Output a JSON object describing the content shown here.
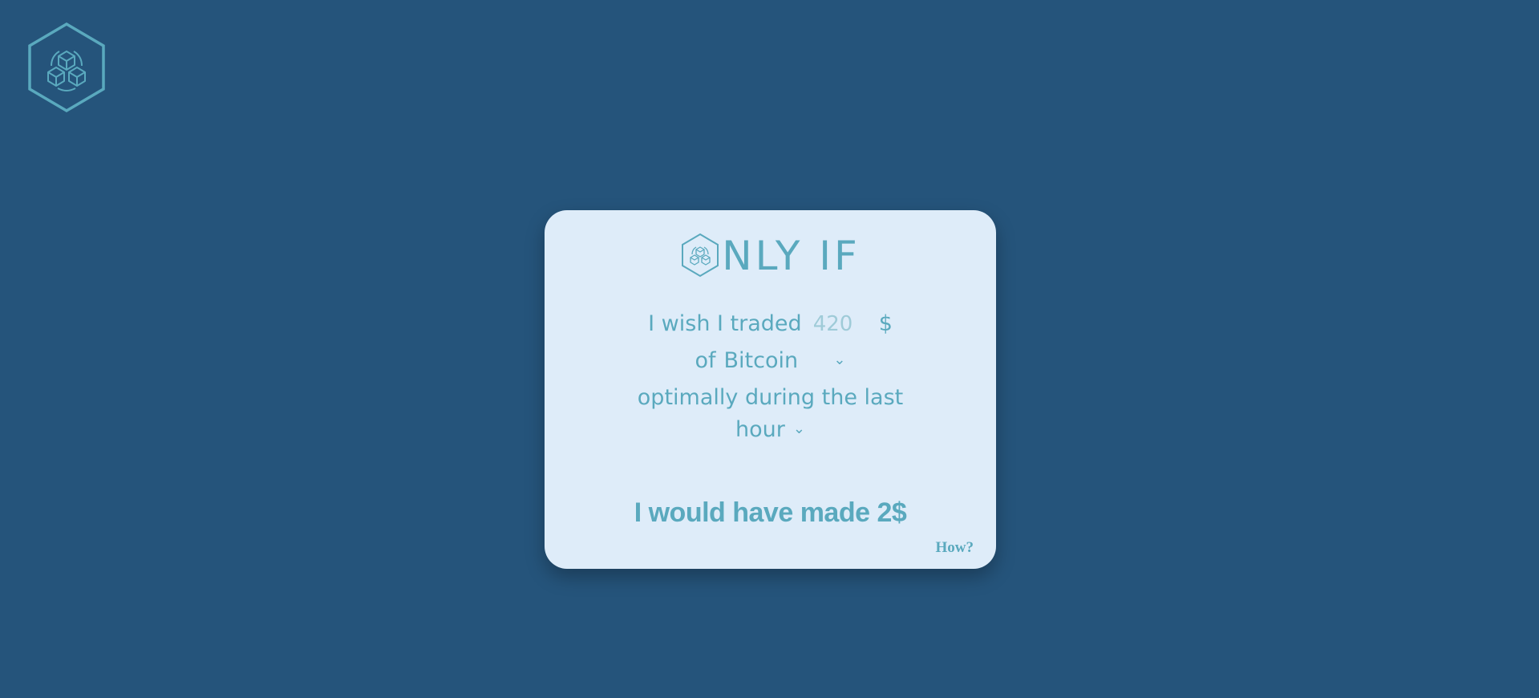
{
  "app": {
    "brand_text": "NLY IF",
    "logo_icon": "hexagon-cubes-icon"
  },
  "form": {
    "prefix_label": "I wish I traded",
    "amount_placeholder": "420",
    "currency_symbol": "$",
    "of_label": "of",
    "crypto_selected": "Bitcoin",
    "sentence_middle": "optimally during the last",
    "period_selected": "hour"
  },
  "result": {
    "text": "I would have made 2$"
  },
  "links": {
    "how_label": "How?"
  },
  "colors": {
    "background": "#25547b",
    "card": "#deecf9",
    "accent": "#5aa9be"
  }
}
